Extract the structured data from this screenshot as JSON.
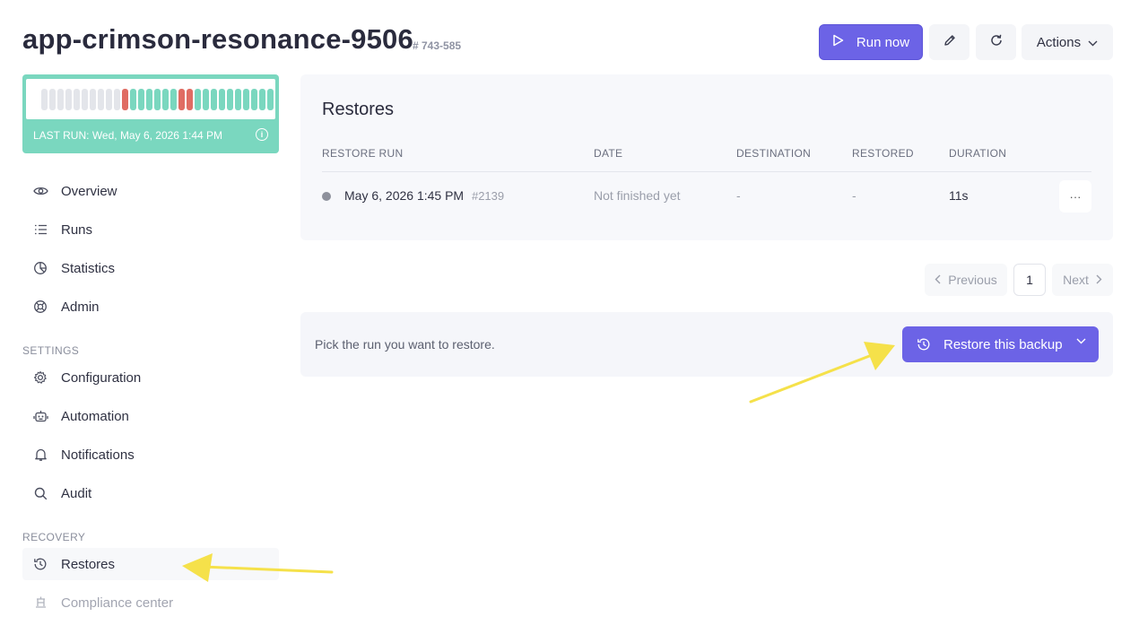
{
  "header": {
    "title": "app-crimson-resonance-9506",
    "id": "# 743-585",
    "run_now_label": "Run now",
    "actions_label": "Actions"
  },
  "status": {
    "last_run_prefix": "LAST RUN:",
    "last_run_value": "Wed, May 6, 2026 1:44 PM",
    "colors": {
      "card": "#7ad7bf",
      "empty": "#e3e5ea",
      "success": "#7ad7bf",
      "failure": "#e06c63"
    },
    "bars": [
      "empty",
      "empty",
      "empty",
      "empty",
      "empty",
      "empty",
      "empty",
      "empty",
      "empty",
      "empty",
      "failure",
      "success",
      "success",
      "success",
      "success",
      "success",
      "success",
      "failure",
      "failure",
      "success",
      "success",
      "success",
      "success",
      "success",
      "success",
      "success",
      "success",
      "success",
      "success"
    ]
  },
  "sidebar": {
    "items": [
      {
        "label": "Overview",
        "icon": "eye-icon"
      },
      {
        "label": "Runs",
        "icon": "list-icon"
      },
      {
        "label": "Statistics",
        "icon": "chart-icon"
      },
      {
        "label": "Admin",
        "icon": "lifebuoy-icon"
      }
    ],
    "settings_label": "SETTINGS",
    "settings": [
      {
        "label": "Configuration",
        "icon": "gear-icon"
      },
      {
        "label": "Automation",
        "icon": "robot-icon"
      },
      {
        "label": "Notifications",
        "icon": "bell-icon"
      },
      {
        "label": "Audit",
        "icon": "search-icon"
      }
    ],
    "recovery_label": "RECOVERY",
    "recovery": [
      {
        "label": "Restores",
        "icon": "history-icon"
      },
      {
        "label": "Compliance center",
        "icon": "compliance-icon"
      }
    ]
  },
  "restores": {
    "title": "Restores",
    "columns": [
      "RESTORE RUN",
      "DATE",
      "DESTINATION",
      "RESTORED",
      "DURATION"
    ],
    "rows": [
      {
        "run": "May 6, 2026 1:45 PM",
        "run_id": "#2139",
        "date": "Not finished yet",
        "destination": "-",
        "restored": "-",
        "duration": "11s",
        "more": "···"
      }
    ]
  },
  "pagination": {
    "previous": "Previous",
    "page": "1",
    "next": "Next"
  },
  "restore_bar": {
    "hint": "Pick the run you want to restore.",
    "button_label": "Restore this backup"
  },
  "colors": {
    "accent": "#6c63e6",
    "annotation_arrow": "#f5e14a"
  }
}
